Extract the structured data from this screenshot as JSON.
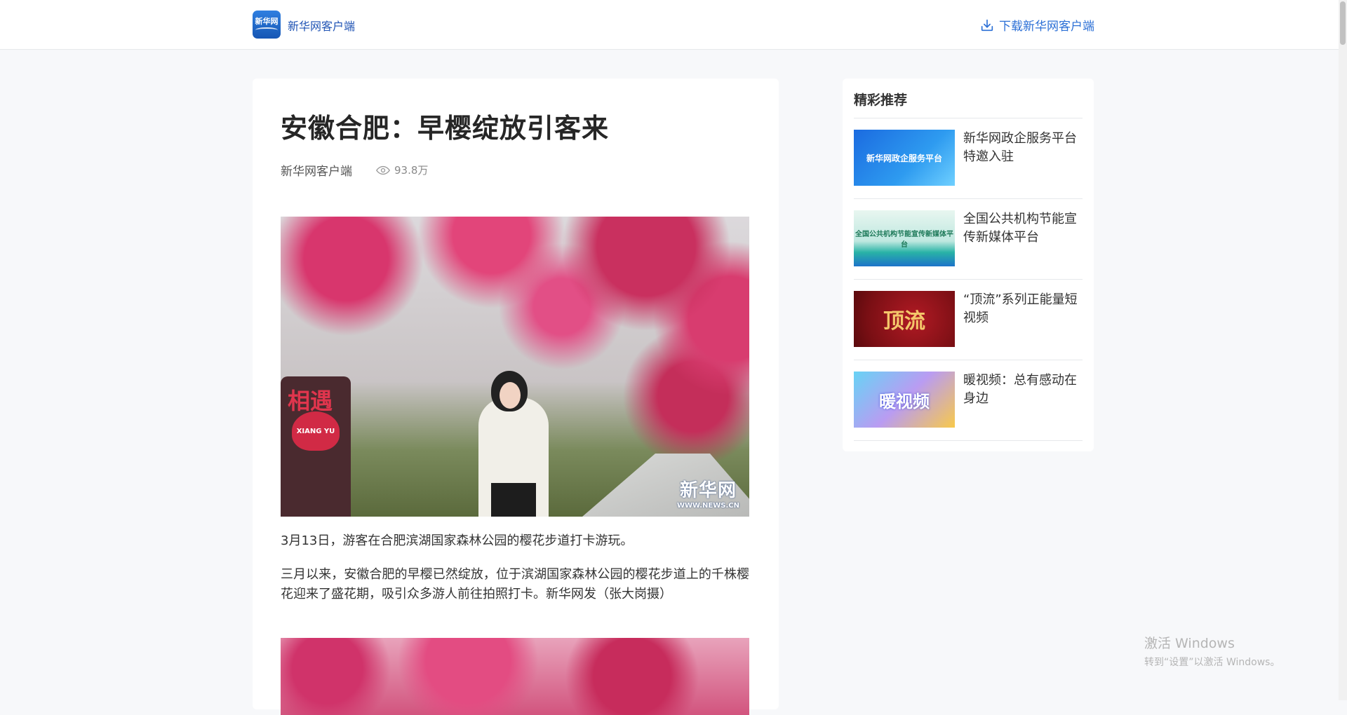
{
  "header": {
    "logo_text": "新华网",
    "brand_name": "新华网客户端",
    "download_label": "下载新华网客户端"
  },
  "article": {
    "title": "安徽合肥：早樱绽放引客来",
    "source": "新华网客户端",
    "views": "93.8万",
    "photo_watermark_main": "新华网",
    "photo_watermark_sub": "WWW.NEWS.CN",
    "sign_text_top": "相遇",
    "sign_text_heart": "XIANG YU",
    "caption": "3月13日，游客在合肥滨湖国家森林公园的樱花步道打卡游玩。",
    "paragraph": "三月以来，安徽合肥的早樱已然绽放，位于滨湖国家森林公园的樱花步道上的千株樱花迎来了盛花期，吸引众多游人前往拍照打卡。新华网发（张大岗摄）"
  },
  "sidebar": {
    "title": "精彩推荐",
    "items": [
      {
        "title": "新华网政企服务平台特邀入驻",
        "thumb_text": "新华网政企服务平台"
      },
      {
        "title": "全国公共机构节能宣传新媒体平台",
        "thumb_text": "全国公共机构节能宣传新媒体平台"
      },
      {
        "title": "“顶流”系列正能量短视频",
        "thumb_text": "顶流"
      },
      {
        "title": "暖视频：总有感动在身边",
        "thumb_text": "暖视频"
      }
    ]
  },
  "system": {
    "activation_title": "激活 Windows",
    "activation_sub": "转到“设置”以激活 Windows。"
  },
  "colors": {
    "brand_blue": "#1f53b4",
    "link_blue": "#2b6fd6",
    "page_bg": "#f7f8fa"
  }
}
